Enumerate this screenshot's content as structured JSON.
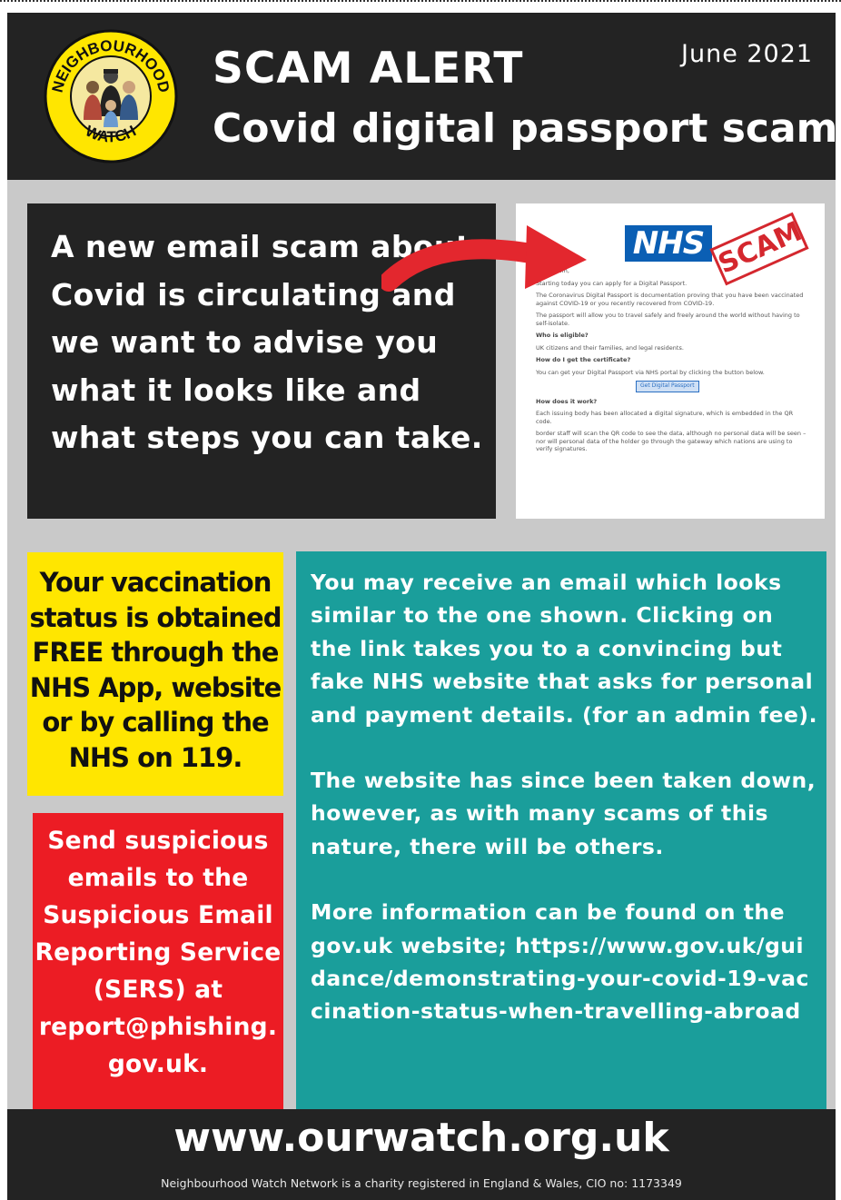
{
  "header": {
    "logo_top_text": "NEIGHBOURHOOD",
    "logo_bottom_text": "WATCH",
    "title": "SCAM ALERT",
    "subtitle": "Covid digital passport scam",
    "date": "June 2021"
  },
  "intro": {
    "text": "A new email scam about Covid is circulating and we want to advise you what it looks like and what steps you can take."
  },
  "email_example": {
    "logo": "NHS",
    "stamp": "SCAM",
    "greeting": "Sir/Madam,",
    "line1": "Starting today you can apply for a Digital Passport.",
    "line2": "The Coronavirus Digital Passport is documentation proving that you have been vaccinated against COVID-19 or you recently recovered from COVID-19.",
    "line3": "The passport will allow you to travel safely and freely around the world without having to self-isolate.",
    "q1": "Who is eligible?",
    "a1": "UK citizens and their families, and legal residents.",
    "q2": "How do I get the certificate?",
    "a2": "You can get your Digital Passport via NHS portal by clicking the button below.",
    "button": "Get Digital Passport",
    "q3": "How does it work?",
    "a3": "Each issuing body has been allocated a digital signature, which is embedded in the QR code.",
    "a4": "border staff will scan the QR code to see the data, although no personal data will be seen – nor will personal data of the holder go through the gateway which nations are using to verify signatures."
  },
  "yellow_box": {
    "text": "Your vaccination status is obtained FREE through the NHS App, website or by calling the NHS on 119."
  },
  "red_box": {
    "text": "Send suspicious emails to the Suspicious Email Reporting Service (SERS) at report@phishing. gov.uk."
  },
  "teal_box": {
    "para1": "You may receive an email which looks similar to the one shown.  Clicking on the link takes you to a convincing but fake NHS website that asks for personal and payment details. (for an admin fee).",
    "para2": "The website has since been taken down, however, as with many scams of this nature, there will be others.",
    "para3": "More information can be found on the gov.uk website;",
    "link": "https://www.gov.uk/guidance/demonstrating-your-covid-19-vaccination-status-when-travelling-abroad"
  },
  "footer": {
    "url": "www.ourwatch.org.uk",
    "note": "Neighbourhood Watch Network is a charity registered in England & Wales, CIO no: 1173349"
  },
  "colors": {
    "dark": "#232323",
    "yellow": "#ffe600",
    "red": "#ec1c24",
    "teal": "#1a9e9b",
    "nhs_blue": "#0b5fb4"
  }
}
